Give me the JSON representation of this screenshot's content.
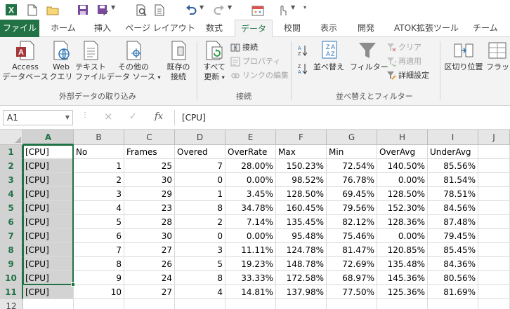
{
  "quick_access": {
    "items": [
      "excel-logo",
      "save",
      "new",
      "open",
      "save-as",
      "print-preview",
      "quick-print",
      "undo",
      "redo",
      "custom",
      "touch-mode",
      "customize"
    ]
  },
  "tabs": [
    "ファイル",
    "ホーム",
    "挿入",
    "ページ レイアウト",
    "数式",
    "データ",
    "校閲",
    "表示",
    "開発",
    "ATOK拡張ツール",
    "チーム"
  ],
  "active_tab": "データ",
  "ribbon": {
    "external_data": {
      "access": [
        "Access",
        "データベース"
      ],
      "web": [
        "Web",
        "クエリ"
      ],
      "text": [
        "テキスト",
        "ファイル"
      ],
      "other": [
        "その他の",
        "データ ソース"
      ],
      "existing": [
        "既存の",
        "接続"
      ],
      "label": "外部データの取り込み"
    },
    "connections": {
      "refresh_all": [
        "すべて",
        "更新"
      ],
      "connections": "接続",
      "properties": "プロパティ",
      "edit_links": "リンクの編集",
      "label": "接続"
    },
    "sort_filter": {
      "sort": "並べ替え",
      "filter": "フィルター",
      "clear": "クリア",
      "reapply": "再適用",
      "advanced": "詳細設定",
      "label": "並べ替えとフィルター"
    },
    "data_tools": {
      "text_to_columns": "区切り位置",
      "flash_fill": "フラッシュ"
    }
  },
  "formula_bar": {
    "name_box": "A1",
    "cancel": "×",
    "enter": "✓",
    "fx": "fx",
    "value": "[CPU]"
  },
  "grid": {
    "columns": [
      "A",
      "B",
      "C",
      "D",
      "E",
      "F",
      "G",
      "H",
      "I",
      "J"
    ],
    "row_numbers": [
      "1",
      "2",
      "3",
      "4",
      "5",
      "6",
      "7",
      "8",
      "9",
      "10",
      "11",
      "12"
    ],
    "headers": [
      "[CPU]",
      "No",
      "Frames",
      "Overed",
      "OverRate",
      "Max",
      "Min",
      "OverAvg",
      "UnderAvg"
    ],
    "rows": [
      [
        "[CPU]",
        "1",
        "25",
        "7",
        "28.00%",
        "150.23%",
        "72.54%",
        "140.50%",
        "85.56%"
      ],
      [
        "[CPU]",
        "2",
        "30",
        "0",
        "0.00%",
        "98.52%",
        "76.78%",
        "0.00%",
        "81.54%"
      ],
      [
        "[CPU]",
        "3",
        "29",
        "1",
        "3.45%",
        "128.50%",
        "69.45%",
        "128.50%",
        "78.51%"
      ],
      [
        "[CPU]",
        "4",
        "23",
        "8",
        "34.78%",
        "160.45%",
        "79.56%",
        "152.30%",
        "84.56%"
      ],
      [
        "[CPU]",
        "5",
        "28",
        "2",
        "7.14%",
        "135.45%",
        "82.12%",
        "128.36%",
        "87.48%"
      ],
      [
        "[CPU]",
        "6",
        "30",
        "0",
        "0.00%",
        "95.48%",
        "75.46%",
        "0.00%",
        "79.45%"
      ],
      [
        "[CPU]",
        "7",
        "27",
        "3",
        "11.11%",
        "124.78%",
        "81.47%",
        "120.85%",
        "85.45%"
      ],
      [
        "[CPU]",
        "8",
        "26",
        "5",
        "19.23%",
        "148.78%",
        "72.69%",
        "135.48%",
        "84.36%"
      ],
      [
        "[CPU]",
        "9",
        "24",
        "8",
        "33.33%",
        "172.58%",
        "68.97%",
        "145.36%",
        "80.56%"
      ],
      [
        "[CPU]",
        "10",
        "27",
        "4",
        "14.81%",
        "137.98%",
        "77.50%",
        "125.36%",
        "81.69%"
      ]
    ]
  },
  "colors": {
    "excel_green": "#217346",
    "ribbon_bg": "#f3f3f3",
    "header_bg": "#e6e6e6",
    "selection": "#d3d3d3"
  }
}
